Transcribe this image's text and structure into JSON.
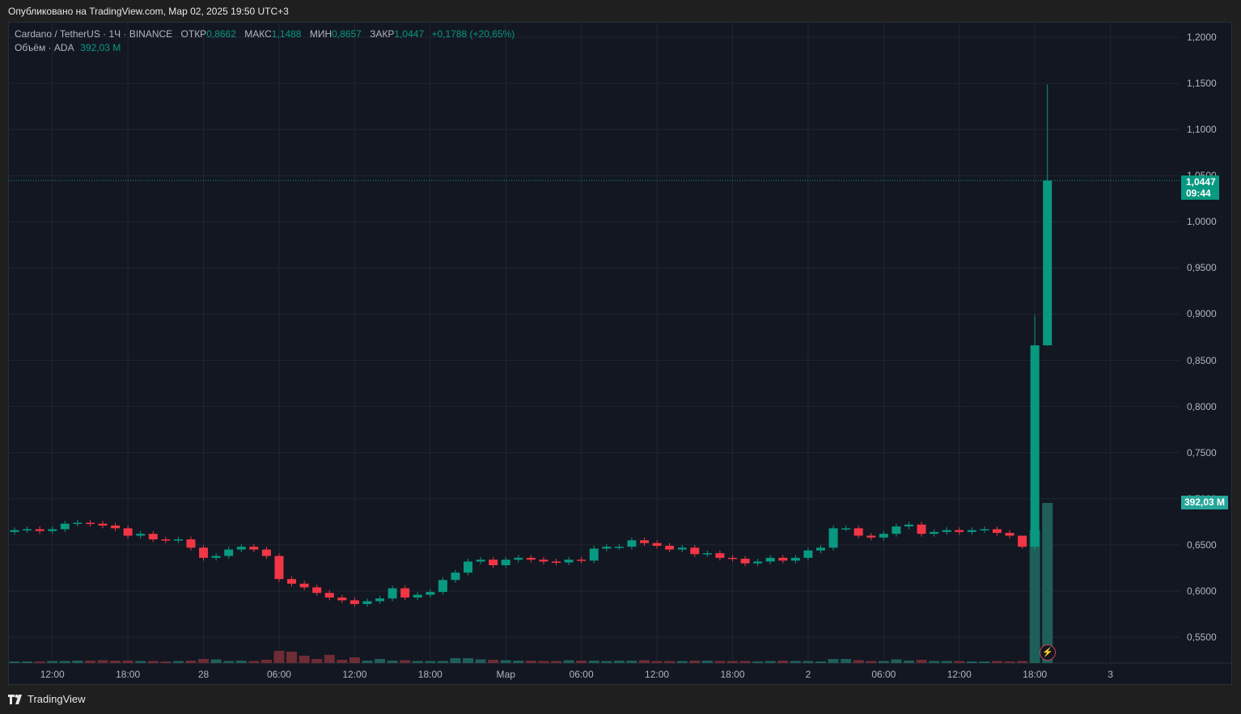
{
  "published": "Опубликовано на TradingView.com, Мар 02, 2025 19:50 UTC+3",
  "legend": {
    "symbol": "Cardano / TetherUS · 1Ч · BINANCE",
    "open_label": "ОТКР",
    "open": "0,8662",
    "high_label": "МАКС",
    "high": "1,1488",
    "low_label": "МИН",
    "low": "0,8657",
    "close_label": "ЗАКР",
    "close": "1,0447",
    "change": "+0,1788 (+20,65%)",
    "volume_title": "Объём · ADA",
    "volume_value": "392,03 M"
  },
  "price_tag": {
    "price": "1,0447",
    "countdown": "09:44"
  },
  "volume_tag": "392,03 M",
  "logo": "TradingView",
  "colors": {
    "up": "#089981",
    "down": "#f23645",
    "vol_up": "#1f5f5a",
    "vol_down": "#6e2c35",
    "bg": "#131722",
    "grid": "#22262f"
  },
  "chart_data": {
    "type": "candlestick",
    "interval": "1h",
    "price_axis": [
      "1,2000",
      "1,1500",
      "1,1000",
      "1,0500",
      "1,0000",
      "0,9500",
      "0,9000",
      "0,8500",
      "0,8000",
      "0,7500",
      "0,7000",
      "0,6500",
      "0,6000",
      "0,5500"
    ],
    "price_axis_values": [
      1.2,
      1.15,
      1.1,
      1.05,
      1.0,
      0.95,
      0.9,
      0.85,
      0.8,
      0.75,
      0.7,
      0.65,
      0.6,
      0.55
    ],
    "time_axis": [
      {
        "label": "12:00",
        "index": 3
      },
      {
        "label": "18:00",
        "index": 9
      },
      {
        "label": "28",
        "index": 15
      },
      {
        "label": "06:00",
        "index": 21
      },
      {
        "label": "12:00",
        "index": 27
      },
      {
        "label": "18:00",
        "index": 33
      },
      {
        "label": "Мар",
        "index": 39
      },
      {
        "label": "06:00",
        "index": 45
      },
      {
        "label": "12:00",
        "index": 51
      },
      {
        "label": "18:00",
        "index": 57
      },
      {
        "label": "2",
        "index": 63
      },
      {
        "label": "06:00",
        "index": 69
      },
      {
        "label": "12:00",
        "index": 75
      },
      {
        "label": "18:00",
        "index": 81
      },
      {
        "label": "3",
        "index": 87
      }
    ],
    "first_open": 0.664,
    "closes": [
      0.666,
      0.667,
      0.665,
      0.667,
      0.673,
      0.674,
      0.673,
      0.671,
      0.668,
      0.66,
      0.662,
      0.656,
      0.655,
      0.656,
      0.647,
      0.636,
      0.638,
      0.645,
      0.648,
      0.645,
      0.638,
      0.613,
      0.608,
      0.604,
      0.598,
      0.593,
      0.59,
      0.586,
      0.589,
      0.592,
      0.603,
      0.593,
      0.596,
      0.599,
      0.612,
      0.62,
      0.632,
      0.634,
      0.628,
      0.634,
      0.636,
      0.634,
      0.632,
      0.631,
      0.634,
      0.633,
      0.646,
      0.648,
      0.648,
      0.655,
      0.652,
      0.649,
      0.645,
      0.647,
      0.64,
      0.641,
      0.636,
      0.635,
      0.63,
      0.632,
      0.636,
      0.633,
      0.636,
      0.644,
      0.647,
      0.668,
      0.668,
      0.66,
      0.658,
      0.662,
      0.67,
      0.672,
      0.662,
      0.664,
      0.666,
      0.664,
      0.666,
      0.667,
      0.663,
      0.66,
      0.648,
      0.8662,
      1.0447
    ],
    "overrides": {
      "80": {
        "h": 0.654,
        "l": 0.646
      },
      "81": {
        "h": 0.8987,
        "l": 0.645
      },
      "82": {
        "h": 1.1488,
        "l": 0.8657
      }
    },
    "volumes_m": [
      4,
      4,
      4,
      5,
      5,
      6,
      6,
      7,
      6,
      6,
      5,
      5,
      4,
      5,
      6,
      10,
      9,
      5,
      6,
      5,
      8,
      30,
      28,
      18,
      10,
      20,
      8,
      14,
      6,
      10,
      6,
      7,
      5,
      5,
      5,
      12,
      12,
      9,
      8,
      7,
      6,
      6,
      5,
      5,
      7,
      6,
      6,
      5,
      6,
      6,
      7,
      5,
      5,
      5,
      6,
      6,
      5,
      5,
      5,
      4,
      5,
      6,
      5,
      5,
      4,
      10,
      10,
      7,
      5,
      5,
      9,
      6,
      8,
      5,
      5,
      5,
      4,
      4,
      5,
      4,
      5,
      325,
      392.03
    ]
  }
}
